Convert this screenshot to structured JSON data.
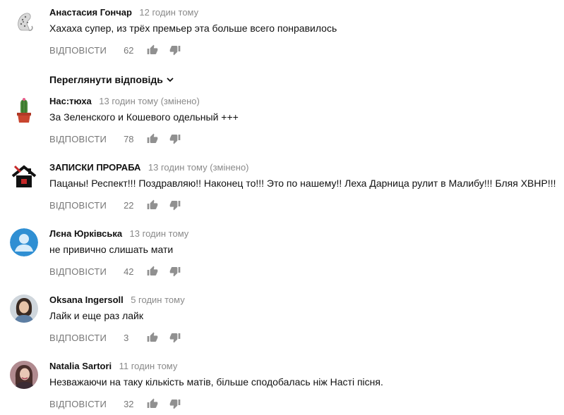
{
  "labels": {
    "reply": "ВІДПОВІСТИ",
    "view_replies": "Переглянути відповідь"
  },
  "comments": [
    {
      "author": "Анастасия Гончар",
      "time": "12 годин тому",
      "text": "Хахаха супер, из трёх премьер эта больше всего понравилось",
      "likes": "62",
      "avatar": "snow-leopard-avatar"
    },
    {
      "author": "Нас:тюха",
      "time": "13 годин тому (змінено)",
      "text": "За Зеленского и Кошевого одельный +++",
      "likes": "78",
      "avatar": "cactus-avatar"
    },
    {
      "author": "ЗАПИСКИ ПРОРАБА",
      "time": "13 годин тому (змінено)",
      "text": "Пацаны! Респект!!! Поздравляю!! Наконец то!!! Это по нашему!! Леха Дарница рулит в Малибу!!! Бляя ХВНР!!!",
      "likes": "22",
      "avatar": "house-logo-avatar"
    },
    {
      "author": "Лєна Юрківська",
      "time": "13 годин тому",
      "text": "не привично слишать мати",
      "likes": "42",
      "avatar": "default-user-avatar"
    },
    {
      "author": "Oksana Ingersoll",
      "time": "5 годин тому",
      "text": "Лайк и еще раз лайк",
      "likes": "3",
      "avatar": "woman-photo-avatar"
    },
    {
      "author": "Natalia Sartori",
      "time": "11 годин тому",
      "text": "Незважаючи на таку кількість матів, більше сподобалась ніж Насті пісня.",
      "likes": "32",
      "avatar": "woman-photo-avatar-2"
    }
  ],
  "colors": {
    "text": "#111111",
    "muted": "#8a8a8a",
    "action": "#777777",
    "default_avatar": "#2f8fd3"
  }
}
